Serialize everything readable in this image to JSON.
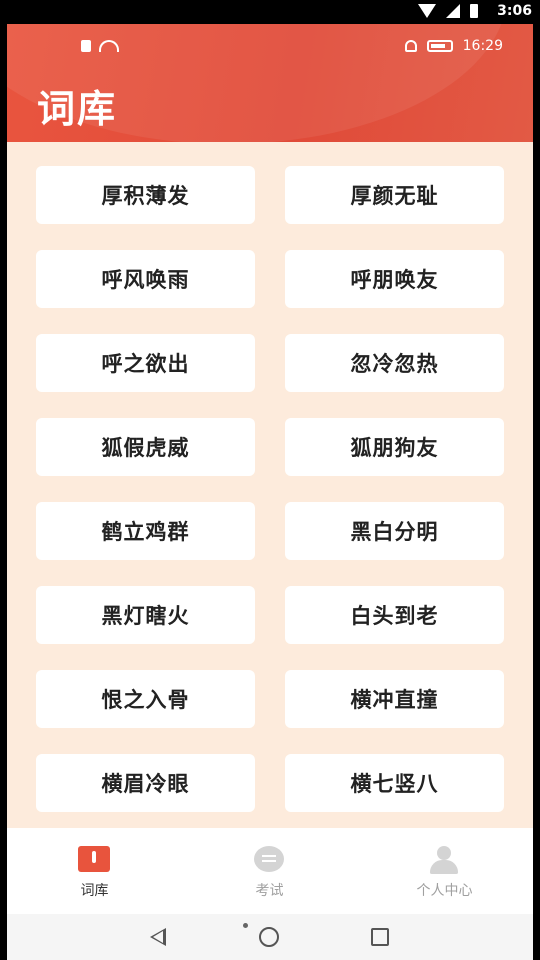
{
  "status_bar": {
    "time": "3:06"
  },
  "app_status": {
    "time": "16:29"
  },
  "header": {
    "title": "词库"
  },
  "words": [
    "厚积薄发",
    "厚颜无耻",
    "呼风唤雨",
    "呼朋唤友",
    "呼之欲出",
    "忽冷忽热",
    "狐假虎威",
    "狐朋狗友",
    "鹤立鸡群",
    "黑白分明",
    "黑灯瞎火",
    "白头到老",
    "恨之入骨",
    "横冲直撞",
    "横眉冷眼",
    "横七竖八"
  ],
  "tabs": [
    {
      "label": "词库",
      "icon": "book-icon",
      "active": true,
      "color": "#333333"
    },
    {
      "label": "考试",
      "icon": "chat-icon",
      "active": false,
      "color": "#a0a0a0"
    },
    {
      "label": "个人中心",
      "icon": "user-icon",
      "active": false,
      "color": "#a0a0a0"
    }
  ],
  "colors": {
    "accent": "#e04a38",
    "background": "#fdebdc"
  }
}
